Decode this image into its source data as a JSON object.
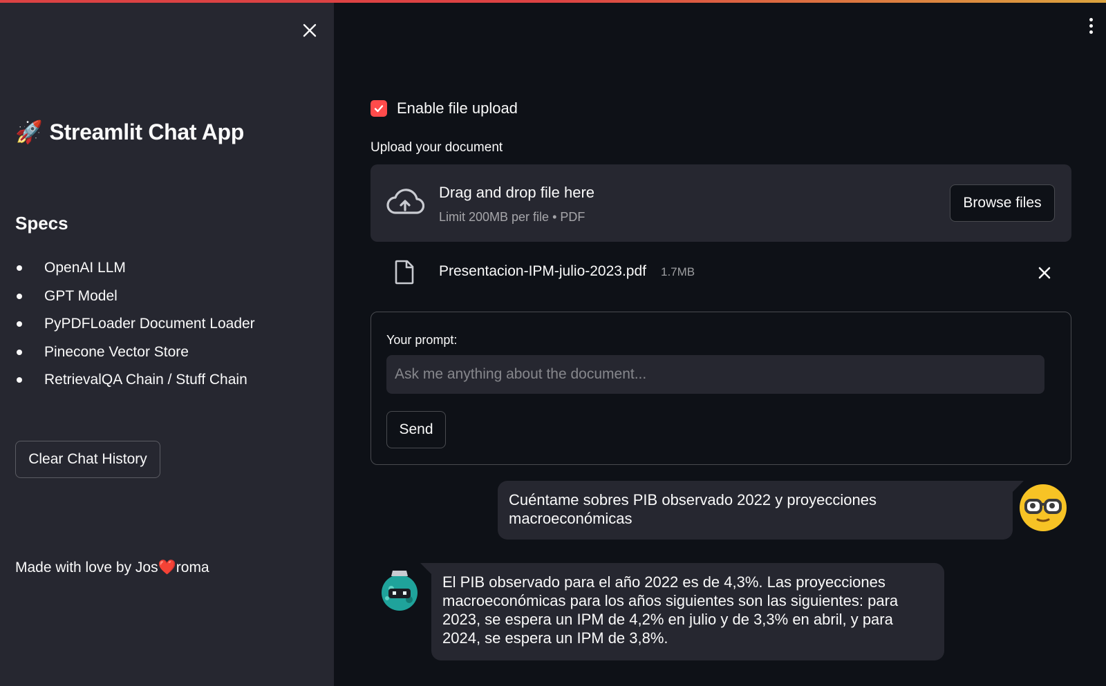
{
  "sidebar": {
    "title_emoji": "🚀",
    "title": "Streamlit Chat App",
    "specs_title": "Specs",
    "specs": [
      "OpenAI LLM",
      "GPT Model",
      "PyPDFLoader Document Loader",
      "Pinecone Vector Store",
      "RetrievalQA Chain / Stuff Chain"
    ],
    "clear_button": "Clear Chat History",
    "made_with_prefix": "Made with love by Jos",
    "made_with_heart": "❤️",
    "made_with_suffix": "roma"
  },
  "main": {
    "enable_upload_label": "Enable file upload",
    "enable_upload_checked": true,
    "upload_label": "Upload your document",
    "dropzone_title": "Drag and drop file here",
    "dropzone_limit": "Limit 200MB per file • PDF",
    "browse_button": "Browse files",
    "uploaded_file": {
      "name": "Presentacion-IPM-julio-2023.pdf",
      "size": "1.7MB"
    },
    "prompt_label": "Your prompt:",
    "prompt_placeholder": "Ask me anything about the document...",
    "send_button": "Send"
  },
  "chat": {
    "user_message": "Cuéntame sobres PIB observado 2022 y proyecciones macroeconómicas",
    "bot_message": "El PIB observado para el año 2022 es de 4,3%. Las proyecciones macroeconómicas para los años siguientes son las siguientes: para 2023, se espera un IPM de 4,2% en julio y de 3,3% en abril, y para 2024, se espera un IPM de 3,8%."
  },
  "colors": {
    "accent": "#ff4b4b",
    "background": "#0e1117",
    "sidebar": "#262730",
    "user_avatar": "#f7c325",
    "bot_avatar": "#1fa39b"
  }
}
